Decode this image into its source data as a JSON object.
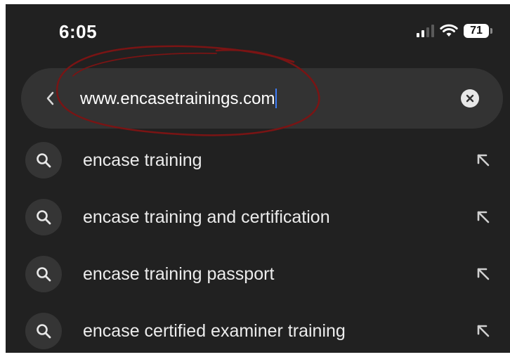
{
  "status_bar": {
    "time": "6:05",
    "battery_level": "71",
    "signal_bars_active": 2,
    "signal_bars_total": 4
  },
  "search_bar": {
    "url_value": "www.encasetrainings.com",
    "back_icon": "chevron-left-icon",
    "clear_icon": "clear-x-icon",
    "annotation_color": "#8b1a1a"
  },
  "suggestions": [
    {
      "label": "encase training",
      "icon": "search-icon",
      "action_icon": "fill-query-arrow-icon"
    },
    {
      "label": "encase training and certification",
      "icon": "search-icon",
      "action_icon": "fill-query-arrow-icon"
    },
    {
      "label": "encase training passport",
      "icon": "search-icon",
      "action_icon": "fill-query-arrow-icon"
    },
    {
      "label": "encase certified examiner training",
      "icon": "search-icon",
      "action_icon": "fill-query-arrow-icon"
    }
  ],
  "colors": {
    "background": "#212121",
    "search_bar": "#333333",
    "caret": "#3d7cf5",
    "text": "#ececec"
  }
}
